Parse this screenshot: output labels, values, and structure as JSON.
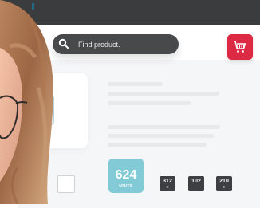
{
  "search": {
    "placeholder": "Find product."
  },
  "stats": {
    "primary": {
      "value": "624",
      "label": "UNITS"
    },
    "secondary": [
      {
        "value": "312",
        "label": "%"
      },
      {
        "value": "102",
        "label": ""
      },
      {
        "value": "210",
        "label": "K"
      }
    ]
  },
  "icons": {
    "search": "search-icon",
    "cart": "shopping-cart-icon"
  },
  "colors": {
    "topbar": "#3a3c3e",
    "search_pill": "#48494b",
    "cart_button": "#dd2a44",
    "metric_primary": "#82cad5",
    "metric_secondary": "#3d3f42"
  }
}
